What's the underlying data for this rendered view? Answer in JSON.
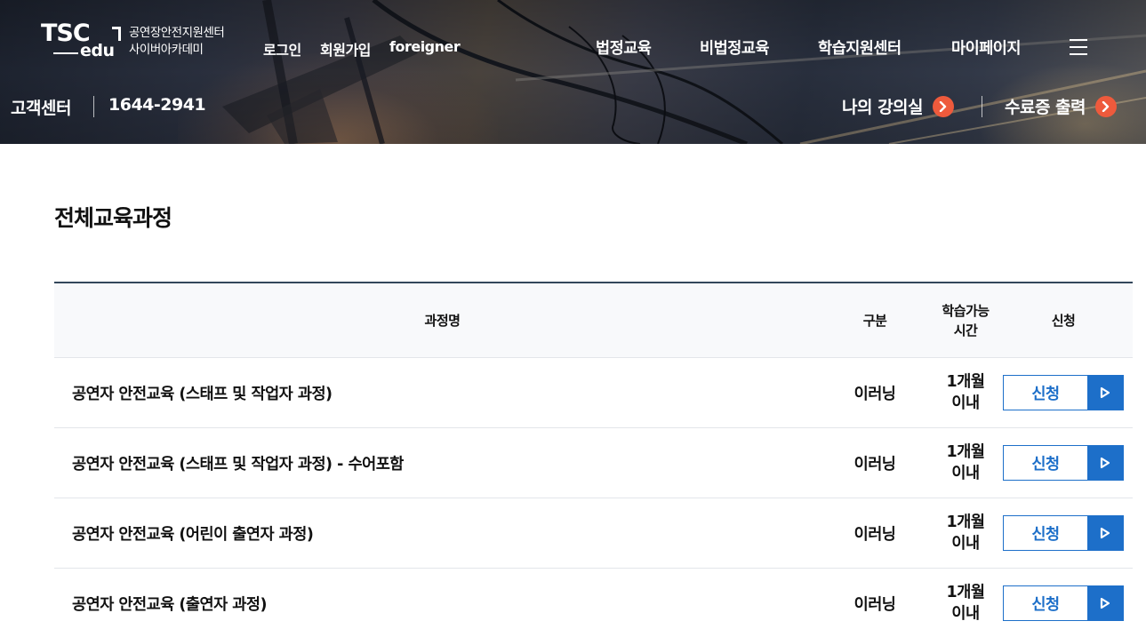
{
  "header": {
    "logo_top": "TSC",
    "logo_bottom": "edu",
    "org_line1": "공연장안전지원센터",
    "org_line2": "사이버아카데미",
    "util": [
      {
        "label": "로그인"
      },
      {
        "label": "회원가입"
      },
      {
        "label": "foreigner"
      }
    ],
    "gnb": [
      {
        "label": "법정교육"
      },
      {
        "label": "비법정교육"
      },
      {
        "label": "학습지원센터"
      },
      {
        "label": "마이페이지"
      }
    ],
    "menu_icon": "hamburger-icon",
    "customer_center": "고객센터",
    "phone": "1644-2941",
    "quick": [
      {
        "label": "나의 강의실",
        "icon": "chevron-right-icon"
      },
      {
        "label": "수료증 출력",
        "icon": "chevron-right-icon"
      }
    ],
    "accent_color": "#ee5a3c"
  },
  "main": {
    "title": "전체교육과정",
    "columns": [
      "과정명",
      "구분",
      "학습가능\n시간",
      "신청"
    ],
    "rows": [
      {
        "name": "공연자 안전교육 (스태프 및 작업자 과정)",
        "type": "이러닝",
        "time": "1개월\n이내",
        "action": "신청"
      },
      {
        "name": "공연자 안전교육 (스태프 및 작업자 과정) - 수어포함",
        "type": "이러닝",
        "time": "1개월\n이내",
        "action": "신청"
      },
      {
        "name": "공연자 안전교육 (어린이 출연자 과정)",
        "type": "이러닝",
        "time": "1개월\n이내",
        "action": "신청"
      },
      {
        "name": "공연자 안전교육 (출연자 과정)",
        "type": "이러닝",
        "time": "1개월\n이내",
        "action": "신청"
      }
    ],
    "button_color": "#1d6fc9",
    "header_border_color": "#33475b"
  }
}
